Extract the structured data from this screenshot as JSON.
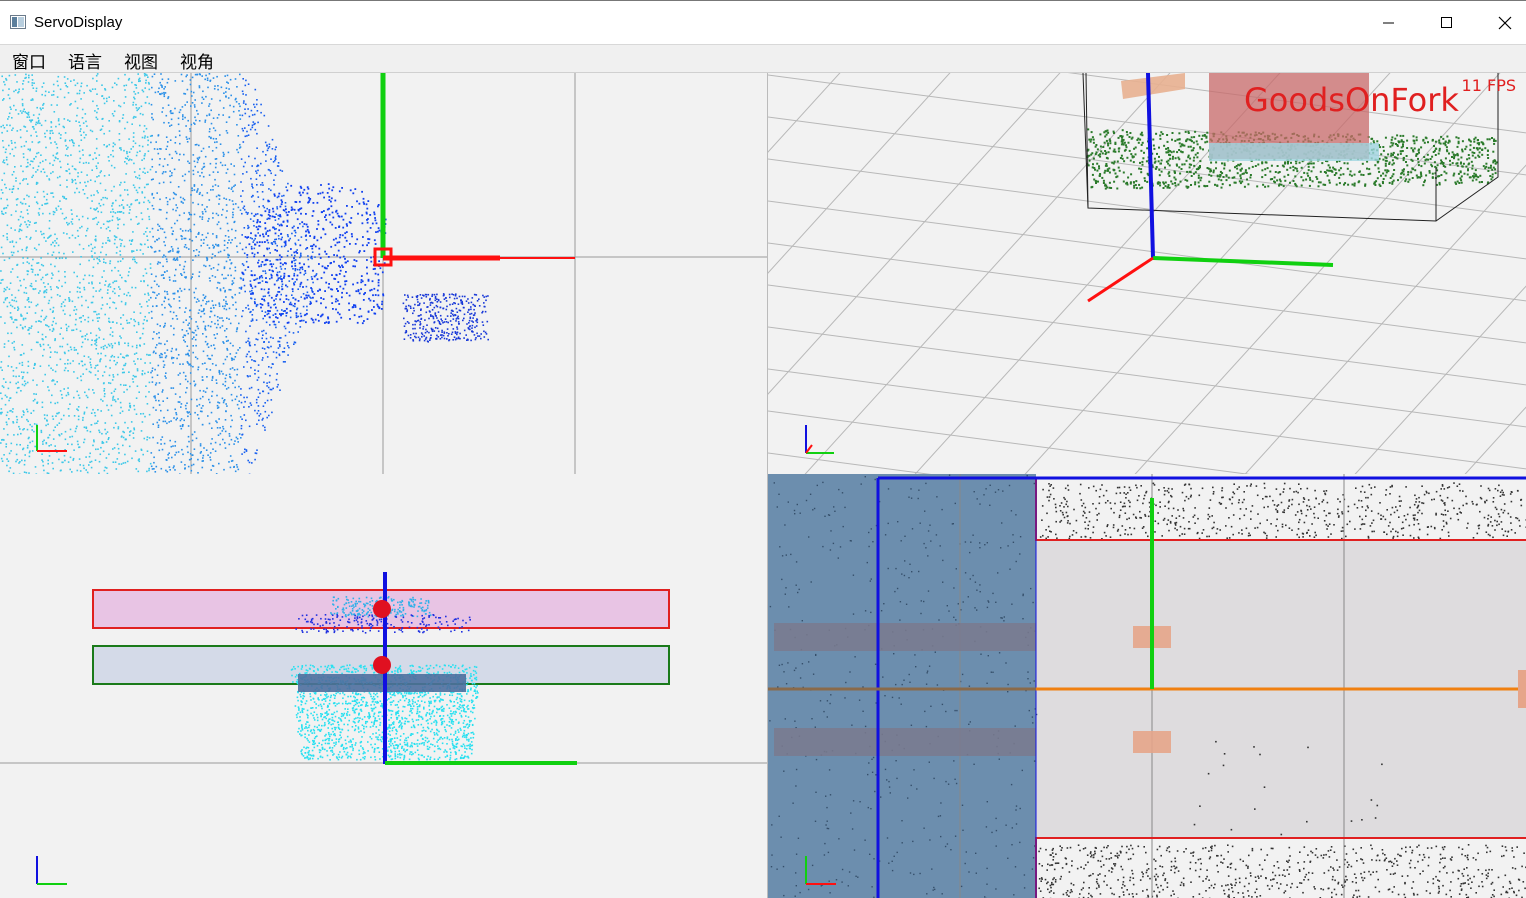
{
  "window": {
    "title": "ServoDisplay",
    "controls": [
      "minimize-icon",
      "maximize-icon",
      "close-icon"
    ]
  },
  "menu": {
    "items": [
      "窗口",
      "语言",
      "视图",
      "视角"
    ]
  },
  "views": {
    "top_left": {
      "name": "top-view"
    },
    "top_right": {
      "name": "perspective-view",
      "fps": "11 FPS",
      "overlay_label": "GoodsOnFork"
    },
    "bottom_left": {
      "name": "front-view"
    },
    "bottom_right": {
      "name": "side-view"
    }
  },
  "colors": {
    "axis_x": "#ff1010",
    "axis_y": "#10d010",
    "axis_z": "#1010e0",
    "point_cyan": "#20c8e8",
    "point_blue": "#1040f0",
    "pallet_green": "#2a7a2a",
    "overlay_red": "#e02020"
  }
}
